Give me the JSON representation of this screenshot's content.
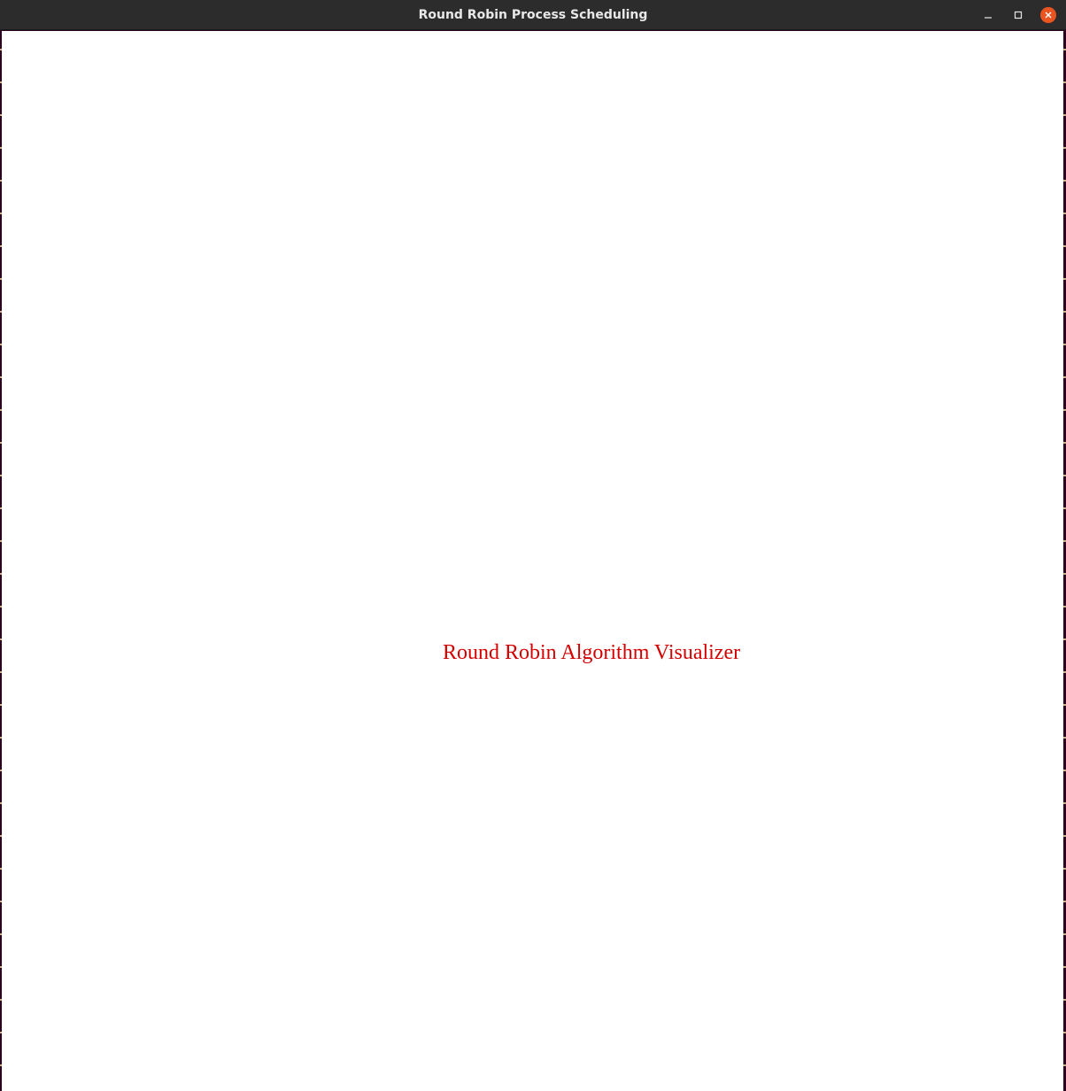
{
  "window": {
    "title": "Round Robin Process Scheduling"
  },
  "controls": {
    "minimize_icon": "minimize-icon",
    "maximize_icon": "maximize-icon",
    "close_icon": "close-icon",
    "close_color": "#e95420"
  },
  "canvas": {
    "label": "Round Robin Algorithm Visualizer",
    "label_color": "#d40000",
    "background": "#ffffff"
  }
}
